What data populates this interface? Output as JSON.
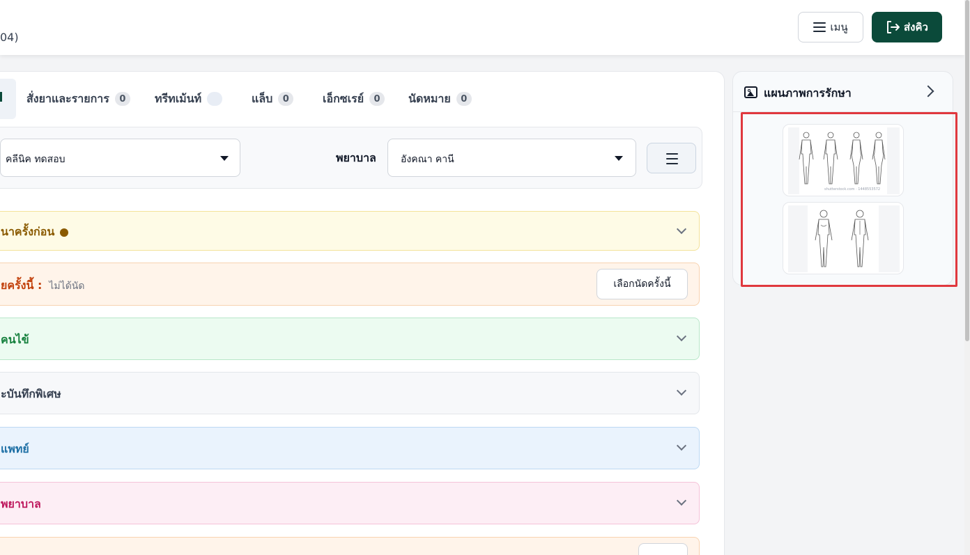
{
  "header": {
    "left_text": "04)",
    "menu_button": {
      "icon": "hamburger-icon",
      "label": "เมนู"
    },
    "send_button": {
      "icon": "logout-arrow-icon",
      "label": "ส่งคิว"
    }
  },
  "tabs": [
    {
      "label": "สั่งยาและรายการ",
      "count": "0"
    },
    {
      "label": "ทรีทเม้นท์",
      "count": ""
    },
    {
      "label": "แล็บ",
      "count": "0"
    },
    {
      "label": "เอ็กซเรย์",
      "count": "0"
    },
    {
      "label": "นัดหมาย",
      "count": "0"
    }
  ],
  "filters": {
    "clinic_value": "คลีนิค ทดสอบ",
    "nurse_label": "พยาบาล",
    "nurse_value": "อังคณา คานี",
    "list_button_icon": "hamburger-icon"
  },
  "sections": [
    {
      "title": "นาครั้งก่อน",
      "color": "#8a5a00"
    },
    {
      "title": "ยครั้งนี้ :",
      "subtext": "ไม่ได้นัด",
      "button_label": "เลือกนัดครั้งนี้",
      "color": "#c2410c"
    },
    {
      "title": "คนไข้",
      "color": "#15803d"
    },
    {
      "title": "ะบันทึกพิเศษ",
      "color": "#374151"
    },
    {
      "title": "แพทย์",
      "color": "#1d6fa5"
    },
    {
      "title": "พยาบาล",
      "color": "#be185d"
    }
  ],
  "side_panel": {
    "title": "แผนภาพการรักษา",
    "icon": "image-icon",
    "thumbnails": [
      {
        "name": "body-chart-front-back-1",
        "caption": "shutterstock.com · 1448553572"
      },
      {
        "name": "body-chart-front-back-2",
        "caption": ""
      }
    ]
  }
}
